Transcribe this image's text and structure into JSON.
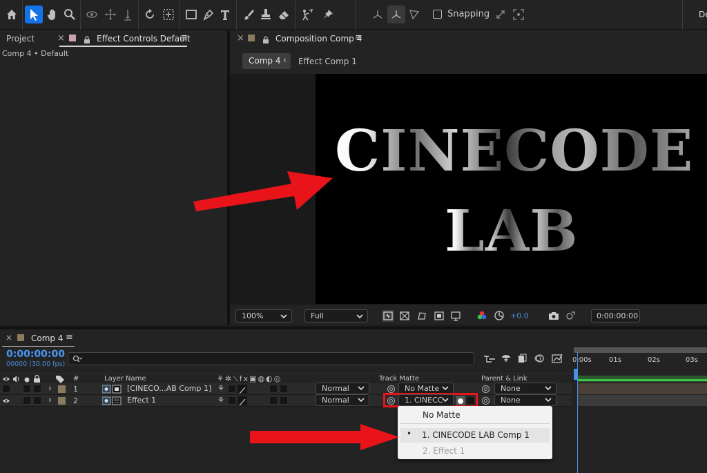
{
  "toolbar": {
    "snapping_label": "Snapping",
    "workspace_label": "De"
  },
  "left_panel": {
    "tab_project": "Project",
    "tab_effect_controls": "Effect Controls Default",
    "subtitle": "Comp 4 • Default"
  },
  "composition": {
    "tab_title": "Composition Comp 4",
    "breadcrumb_active": "Comp 4",
    "breadcrumb_next": "Effect Comp 1",
    "text_line1": "CINECODE",
    "text_line2": "LAB",
    "zoom": "100%",
    "resolution": "Full",
    "exposure": "+0.0",
    "timecode": "0:00:00:00"
  },
  "timeline": {
    "tab_title": "Comp 4",
    "timecode": "0:00:00:00",
    "frame_info": "00000 (30.00 fps)",
    "search_placeholder": "",
    "col_num": "#",
    "col_layer_name": "Layer Name",
    "col_track_matte": "Track Matte",
    "col_parent_link": "Parent & Link",
    "ruler": [
      "0:00s",
      "01s",
      "02s",
      "03s"
    ],
    "layers": [
      {
        "num": "1",
        "name": "[CINECO...AB Comp 1]",
        "mode": "Normal",
        "matte": "No Matte",
        "parent": "None"
      },
      {
        "num": "2",
        "name": "Effect 1",
        "mode": "Normal",
        "matte": "1. CINECC",
        "parent": "None"
      }
    ]
  },
  "matte_menu": {
    "items": [
      "No Matte",
      "1. CINECODE LAB Comp 1",
      "2. Effect 1"
    ],
    "selected_bullet": "•"
  },
  "colors": {
    "accent": "#1473e6",
    "highlight_red": "#e8141a",
    "label_swatch": "#8a7a5e",
    "pink_swatch": "#c9a3b4"
  }
}
